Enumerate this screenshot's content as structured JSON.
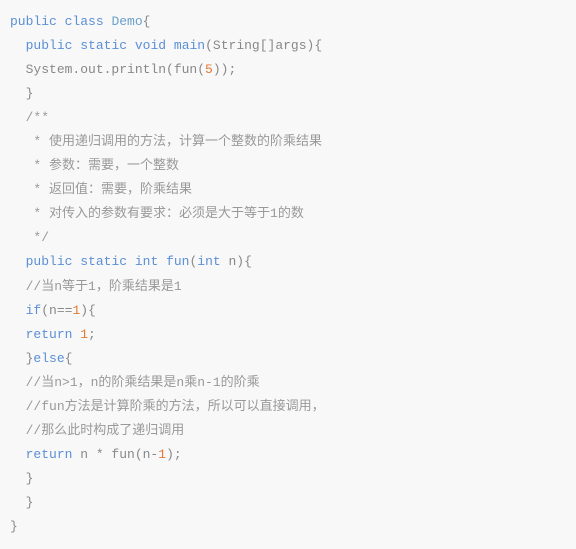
{
  "code": {
    "l1_kw1": "public",
    "l1_kw2": "class",
    "l1_cls": "Demo",
    "l1_b": "{",
    "l2_kw1": "public",
    "l2_kw2": "static",
    "l2_kw3": "void",
    "l2_fn": "main",
    "l2_sig": "(String[]args){",
    "l3_txt": "System.out.println(fun(",
    "l3_num": "5",
    "l3_end": "));",
    "l4": "}",
    "l5": "/**",
    "l6": " * 使用递归调用的方法，计算一个整数的阶乘结果",
    "l7": " * 参数：需要，一个整数",
    "l8": " * 返回值：需要，阶乘结果",
    "l9": " * 对传入的参数有要求：必须是大于等于1的数",
    "l10": " */",
    "l11_kw1": "public",
    "l11_kw2": "static",
    "l11_kw3": "int",
    "l11_fn": "fun",
    "l11_sig1": "(",
    "l11_kw4": "int",
    "l11_sig2": " n){",
    "l12": "//当n等于1，阶乘结果是1",
    "l13_kw": "if",
    "l13_cond": "(n==",
    "l13_num": "1",
    "l13_end": "){",
    "l14_kw": "return",
    "l14_sp": " ",
    "l14_num": "1",
    "l14_end": ";",
    "l15_br": "}",
    "l15_kw": "else",
    "l15_end": "{",
    "l16": "//当n>1，n的阶乘结果是n乘n-1的阶乘",
    "l17": "//fun方法是计算阶乘的方法，所以可以直接调用，",
    "l18": "//那么此时构成了递归调用",
    "l19_kw": "return",
    "l19_txt": " n * fun(n-",
    "l19_num": "1",
    "l19_end": ");",
    "l20": "}",
    "l21": "}",
    "l22": "}"
  }
}
